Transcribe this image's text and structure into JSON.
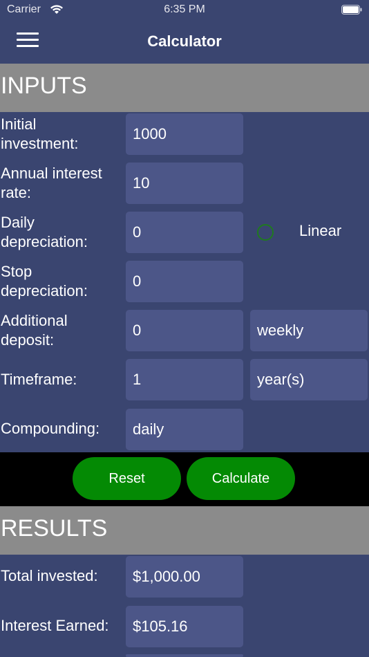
{
  "status_bar": {
    "carrier": "Carrier",
    "time": "6:35 PM"
  },
  "nav": {
    "title": "Calculator"
  },
  "inputs_section": {
    "header": "INPUTS",
    "initial_investment": {
      "label_line1": "Initial",
      "label_line2": "investment:",
      "value": "1000"
    },
    "annual_interest_rate": {
      "label_line1": "Annual interest",
      "label_line2": "rate:",
      "value": "10"
    },
    "daily_depreciation": {
      "label_line1": "Daily",
      "label_line2": "depreciation:",
      "value": "0",
      "option_label": "Linear"
    },
    "stop_depreciation": {
      "label_line1": "Stop",
      "label_line2": "depreciation:",
      "value": "0"
    },
    "additional_deposit": {
      "label_line1": "Additional",
      "label_line2": "deposit:",
      "value": "0",
      "frequency": "weekly"
    },
    "timeframe": {
      "label": "Timeframe:",
      "value": "1",
      "unit": "year(s)"
    },
    "compounding": {
      "label": "Compounding:",
      "value": "daily"
    }
  },
  "buttons": {
    "reset": "Reset",
    "calculate": "Calculate"
  },
  "results_section": {
    "header": "RESULTS",
    "total_invested": {
      "label": "Total invested:",
      "value": "$1,000.00"
    },
    "interest_earned": {
      "label": "Interest Earned:",
      "value": "$105.16"
    }
  },
  "colors": {
    "background": "#3a4570",
    "field": "#4c5688",
    "section_header": "#8b8b8b",
    "button_green": "#048a04",
    "radio_ring": "#1f7a1f"
  },
  "icons": {
    "menu": "hamburger-menu-icon",
    "wifi": "wifi-icon",
    "battery": "battery-icon",
    "radio": "radio-unselected-icon"
  }
}
